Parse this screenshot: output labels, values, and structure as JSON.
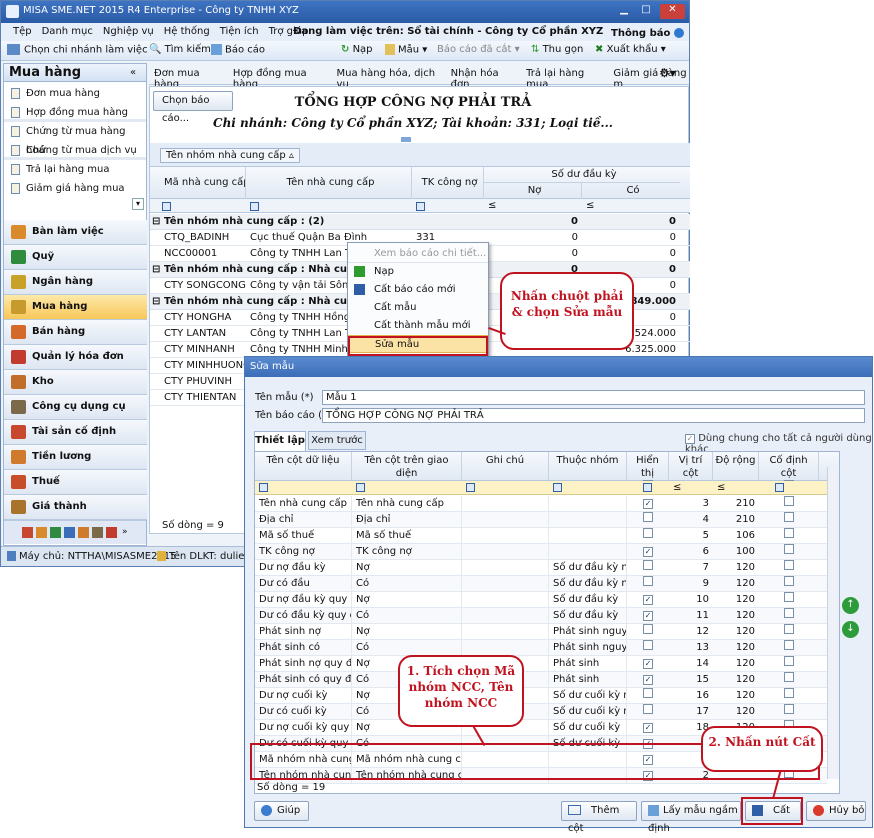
{
  "app": {
    "title": "MISA SME.NET 2015 R4 Enterprise - Công ty TNHH XYZ",
    "menus": [
      "Tệp",
      "Danh mục",
      "Nghiệp vụ",
      "Hệ thống",
      "Tiện ích",
      "Trợ giúp"
    ],
    "working_on": "Đang làm việc trên: Sổ tài chính - Công ty Cổ phần XYZ",
    "notice": "Thông báo"
  },
  "toolbar": {
    "branch": "Chọn chi nhánh làm việc",
    "search": "Tìm kiếm",
    "report": "Báo cáo",
    "load": "Nạp",
    "template": "Mẫu",
    "cut_report": "Báo cáo đã cắt",
    "collapse": "Thu gọn",
    "export": "Xuất khẩu"
  },
  "sidebar": {
    "title": "Mua hàng",
    "links": [
      "Đơn mua hàng",
      "Hợp đồng mua hàng",
      "Chứng từ mua hàng hoá",
      "Chứng từ mua dịch vụ",
      "Trả lại hàng mua",
      "Giảm giá hàng mua"
    ],
    "nav": [
      "Bàn làm việc",
      "Quỹ",
      "Ngân hàng",
      "Mua hàng",
      "Bán hàng",
      "Quản lý hóa đơn",
      "Kho",
      "Công cụ dụng cụ",
      "Tài sản cố định",
      "Tiền lương",
      "Thuế",
      "Giá thành"
    ]
  },
  "tabs": [
    "Đơn mua hàng",
    "Hợp đồng mua hàng",
    "Mua hàng hóa, dịch vụ",
    "Nhận hóa đơn",
    "Trả lại hàng mua",
    "Giảm giá hàng m"
  ],
  "report": {
    "choose_btn": "Chọn báo cáo...",
    "title": "TỔNG HỢP CÔNG NỢ PHẢI TRẢ",
    "subtitle": "Chi nhánh: Công ty Cổ phần XYZ; Tài khoản: 331; Loại tiề...",
    "group_chip": "Tên nhóm nhà cung cấp",
    "headers": {
      "code": "Mã nhà cung cấp",
      "name": "Tên nhà cung cấp",
      "account": "TK công nợ",
      "opening": "Số dư đầu kỳ",
      "debit": "Nợ",
      "credit": "Có"
    },
    "filter_op": "≤",
    "groups": [
      {
        "label": "Tên nhóm nhà cung cấp : (2)",
        "debit": "0",
        "credit": "0"
      },
      {
        "label": "Tên nhóm nhà cung cấp : Nhà cung cấp dịch",
        "debit": "0",
        "credit": "0"
      },
      {
        "label": "Tên nhóm nhà cung cấp : Nhà cung cấp hàn",
        "debit": "",
        "credit": "24.849.000"
      }
    ],
    "rows": [
      {
        "code": "CTQ_BADINH",
        "name": "Cục thuế Quận Ba Đình",
        "account": "331",
        "debit": "0",
        "credit": "0"
      },
      {
        "code": "NCC00001",
        "name": "Công ty TNHH Lan Tân",
        "account": "",
        "debit": "0",
        "credit": "0"
      },
      {
        "code": "CTY SONGCONG",
        "name": "Công ty vận tải Sông Côn",
        "account": "",
        "debit": "0",
        "credit": "0"
      },
      {
        "code": "CTY HONGHA",
        "name": "Công ty TNHH Hồng Hà",
        "account": "",
        "debit": "",
        "credit": "0"
      },
      {
        "code": "CTY LANTAN",
        "name": "Công ty TNHH Lan Tân",
        "account": "",
        "debit": "",
        "credit": "18.524.000"
      },
      {
        "code": "CTY MINHANH",
        "name": "Công ty TNHH Minh Anh",
        "account": "",
        "debit": "",
        "credit": "6.325.000"
      },
      {
        "code": "CTY MINHHUONG",
        "name": "",
        "account": "",
        "debit": "",
        "credit": ""
      },
      {
        "code": "CTY PHUVINH",
        "name": "",
        "account": "",
        "debit": "",
        "credit": ""
      },
      {
        "code": "CTY THIENTAN",
        "name": "",
        "account": "",
        "debit": "",
        "credit": ""
      }
    ],
    "row_count": "Số dòng = 9"
  },
  "context_menu": [
    "Xem báo cáo chi tiết...",
    "Nạp",
    "Cất báo cáo mới",
    "Cất mẫu",
    "Cất thành mẫu mới",
    "Sửa mẫu"
  ],
  "status": {
    "server": "Máy chủ: NTTHA\\MISASME2015",
    "db": "Tên DLKT: dulieuke"
  },
  "dialog": {
    "title": "Sửa mẫu",
    "name_label": "Tên mẫu (*)",
    "name_value": "Mẫu 1",
    "report_label": "Tên báo cáo (*)",
    "report_value": "TỔNG HỢP CÔNG NỢ PHẢI TRẢ",
    "tab_setup": "Thiết lập",
    "tab_preview": "Xem trước",
    "share_label": "Dùng chung cho tất cả người dùng khác",
    "headers": {
      "col": "Tên cột dữ liệu",
      "ui": "Tên cột trên giao diện",
      "note": "Ghi chú",
      "group": "Thuộc nhóm",
      "show": "Hiển thị",
      "pos": "Vị trí cột",
      "width": "Độ rộng",
      "fixed": "Cố định cột"
    },
    "rows": [
      {
        "col": "Tên nhà cung cấp",
        "ui": "Tên nhà cung cấp",
        "group": "",
        "show": true,
        "pos": "3",
        "width": "210"
      },
      {
        "col": "Địa chỉ",
        "ui": "Địa chỉ",
        "group": "",
        "show": false,
        "pos": "4",
        "width": "210"
      },
      {
        "col": "Mã số thuế",
        "ui": "Mã số thuế",
        "group": "",
        "show": false,
        "pos": "5",
        "width": "106"
      },
      {
        "col": "TK công nợ",
        "ui": "TK công nợ",
        "group": "",
        "show": true,
        "pos": "6",
        "width": "100"
      },
      {
        "col": "Dư nợ đầu kỳ",
        "ui": "Nợ",
        "group": "Số dư đầu kỳ ng...",
        "show": false,
        "pos": "7",
        "width": "120"
      },
      {
        "col": "Dư có đầu",
        "ui": "Có",
        "group": "Số dư đầu kỳ ng...",
        "show": false,
        "pos": "9",
        "width": "120"
      },
      {
        "col": "Dư nợ đầu kỳ quy đổi",
        "ui": "Nợ",
        "group": "Số dư đầu kỳ",
        "show": true,
        "pos": "10",
        "width": "120"
      },
      {
        "col": "Dư có đầu kỳ quy đổi",
        "ui": "Có",
        "group": "Số dư đầu kỳ",
        "show": true,
        "pos": "11",
        "width": "120"
      },
      {
        "col": "Phát sinh nợ",
        "ui": "Nợ",
        "group": "Phát sinh nguyê...",
        "show": false,
        "pos": "12",
        "width": "120"
      },
      {
        "col": "Phát sinh có",
        "ui": "Có",
        "group": "Phát sinh nguyê...",
        "show": false,
        "pos": "13",
        "width": "120"
      },
      {
        "col": "Phát sinh nợ quy đổi",
        "ui": "Nợ",
        "group": "Phát sinh",
        "show": true,
        "pos": "14",
        "width": "120"
      },
      {
        "col": "Phát sinh có quy đổi",
        "ui": "Có",
        "group": "Phát sinh",
        "show": true,
        "pos": "15",
        "width": "120"
      },
      {
        "col": "Dư nợ cuối kỳ",
        "ui": "Nợ",
        "group": "Số dư cuối kỳ ng...",
        "show": false,
        "pos": "16",
        "width": "120"
      },
      {
        "col": "Dư có cuối kỳ",
        "ui": "Có",
        "group": "Số dư cuối kỳ ng...",
        "show": false,
        "pos": "17",
        "width": "120"
      },
      {
        "col": "Dư nợ cuối kỳ quy đổi",
        "ui": "Nợ",
        "group": "Số dư cuối kỳ",
        "show": true,
        "pos": "18",
        "width": "120"
      },
      {
        "col": "Dư có cuối kỳ quy đổi",
        "ui": "Có",
        "group": "Số dư cuối kỳ",
        "show": true,
        "pos": "",
        "width": ""
      },
      {
        "col": "Mã nhóm nhà cung c...",
        "ui": "Mã nhóm nhà cung cấp",
        "group": "",
        "show": true,
        "pos": "",
        "width": ""
      },
      {
        "col": "Tên nhóm nhà cung c...",
        "ui": "Tên nhóm nhà cung cấp",
        "group": "",
        "show": true,
        "pos": "2",
        "width": ""
      }
    ],
    "row_count": "Số dòng = 19",
    "help": "Giúp",
    "add_col": "Thêm cột",
    "default_tpl": "Lấy mẫu ngầm định",
    "save": "Cất",
    "cancel": "Hủy bỏ"
  },
  "callouts": {
    "right_click": "Nhấn chuột phải & chọn Sửa mẫu",
    "tick": "1. Tích chọn Mã nhóm NCC, Tên nhóm NCC",
    "press": "2. Nhấn nút Cất"
  }
}
